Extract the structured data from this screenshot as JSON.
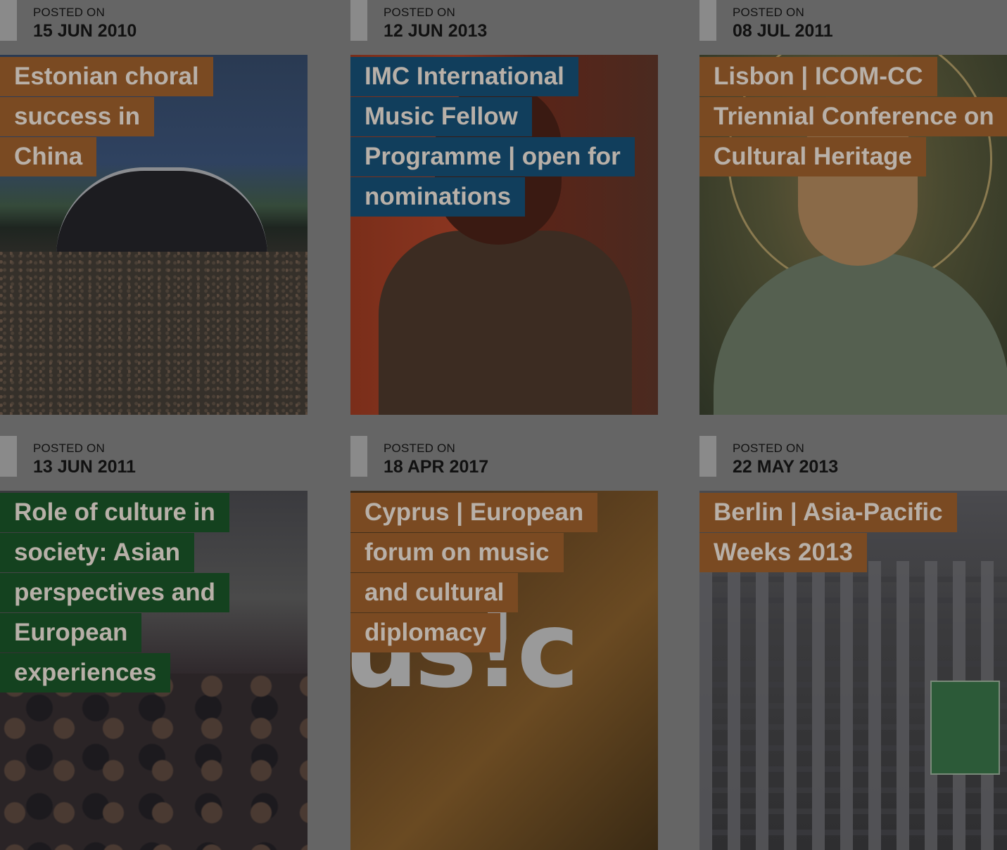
{
  "cards": [
    {
      "posted_label": "POSTED ON",
      "date": "15 JUN 2010",
      "title": "Estonian choral success in China",
      "label_color": "#7a4a22",
      "image": "song-festival-grounds-photo"
    },
    {
      "posted_label": "POSTED ON",
      "date": "12 JUN 2013",
      "title": "IMC International Music Fellow Programme | open for nominations",
      "label_color": "#113e5c",
      "image": "portrait-photo"
    },
    {
      "posted_label": "POSTED ON",
      "date": "08 JUL 2011",
      "title": "Lisbon | ICOM-CC Triennial Conference on Cultural Heritage",
      "label_color": "#7a4a22",
      "image": "renaissance-painting"
    },
    {
      "posted_label": "POSTED ON",
      "date": "13 JUN 2011",
      "title": "Role of culture in society: Asian perspectives and European experiences",
      "label_color": "#14421f",
      "image": "conference-audience-photo"
    },
    {
      "posted_label": "POSTED ON",
      "date": "18 APR 2017",
      "title": "Cyprus | European forum on music and cultural diplomacy",
      "label_color": "#7a4a22",
      "image": "music-graphic",
      "image_text": "us!c"
    },
    {
      "posted_label": "POSTED ON",
      "date": "22 MAY 2013",
      "title": "Berlin | Asia-Pacific Weeks 2013",
      "label_color": "#7a4a22",
      "image": "city-aerial-photo"
    }
  ]
}
